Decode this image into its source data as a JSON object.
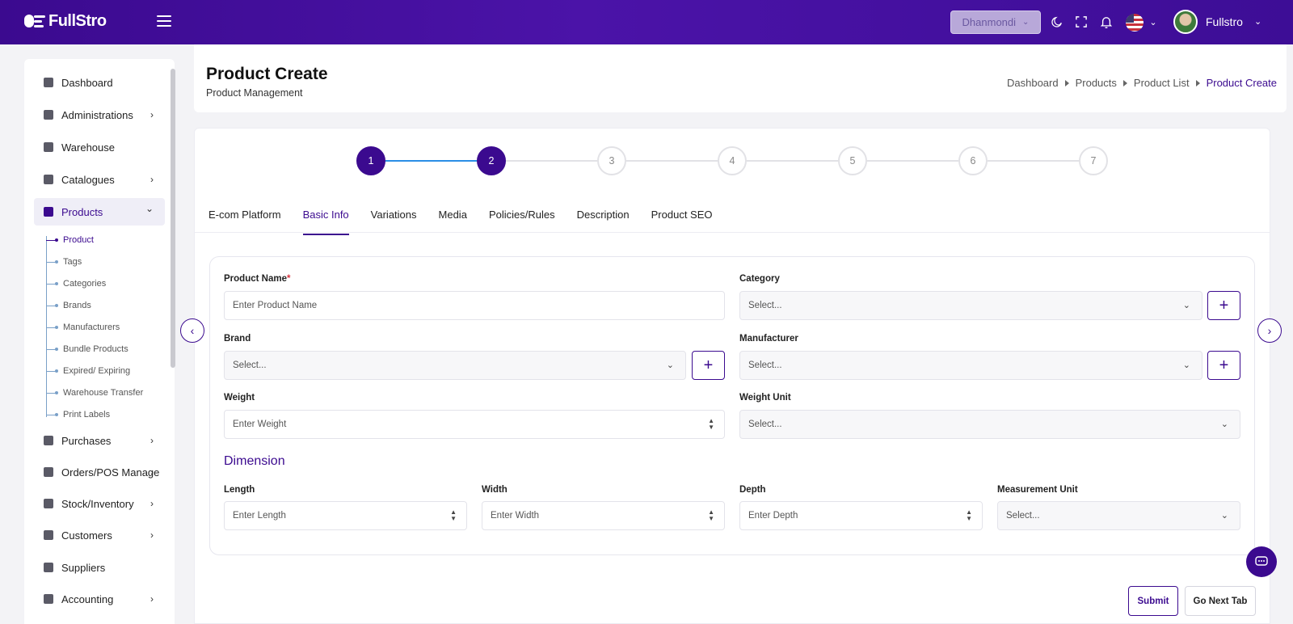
{
  "topbar": {
    "logo_text": "FullStro",
    "branch": "Dhanmondi",
    "user_name": "Fullstro"
  },
  "sidebar": {
    "items": [
      {
        "label": "Dashboard",
        "icon": "monitor-icon"
      },
      {
        "label": "Administrations",
        "icon": "user-gear-icon"
      },
      {
        "label": "Warehouse",
        "icon": "warehouse-icon"
      },
      {
        "label": "Catalogues",
        "icon": "catalogue-icon"
      },
      {
        "label": "Products",
        "icon": "cart-icon"
      },
      {
        "label": "Purchases",
        "icon": "bag-icon"
      },
      {
        "label": "Orders/POS Manage",
        "icon": "clipboard-icon"
      },
      {
        "label": "Stock/Inventory",
        "icon": "box-icon"
      },
      {
        "label": "Customers",
        "icon": "users-icon"
      },
      {
        "label": "Suppliers",
        "icon": "supplier-icon"
      },
      {
        "label": "Accounting",
        "icon": "calculator-icon"
      }
    ],
    "products_sub": [
      "Product",
      "Tags",
      "Categories",
      "Brands",
      "Manufacturers",
      "Bundle Products",
      "Expired/ Expiring",
      "Warehouse Transfer",
      "Print Labels"
    ]
  },
  "header": {
    "title": "Product Create",
    "subtitle": "Product Management",
    "breadcrumb": [
      "Dashboard",
      "Products",
      "Product List",
      "Product Create"
    ]
  },
  "stepper": {
    "steps": [
      "1",
      "2",
      "3",
      "4",
      "5",
      "6",
      "7"
    ],
    "completed": 2
  },
  "tabs": [
    "E-com Platform",
    "Basic Info",
    "Variations",
    "Media",
    "Policies/Rules",
    "Description",
    "Product SEO"
  ],
  "form": {
    "product_name_label": "Product Name",
    "product_name_required": "*",
    "product_name_placeholder": "Enter Product Name",
    "category_label": "Category",
    "category_value": "Select...",
    "brand_label": "Brand",
    "brand_value": "Select...",
    "manufacturer_label": "Manufacturer",
    "manufacturer_value": "Select...",
    "weight_label": "Weight",
    "weight_placeholder": "Enter Weight",
    "weight_unit_label": "Weight Unit",
    "weight_unit_value": "Select...",
    "dimension_title": "Dimension",
    "length_label": "Length",
    "length_placeholder": "Enter Length",
    "width_label": "Width",
    "width_placeholder": "Enter Width",
    "depth_label": "Depth",
    "depth_placeholder": "Enter Depth",
    "measurement_unit_label": "Measurement Unit",
    "measurement_unit_value": "Select...",
    "plus": "+"
  },
  "actions": {
    "submit": "Submit",
    "next": "Go Next Tab"
  },
  "colors": {
    "brand": "#3b0a8f",
    "progress": "#2a8ee6"
  }
}
